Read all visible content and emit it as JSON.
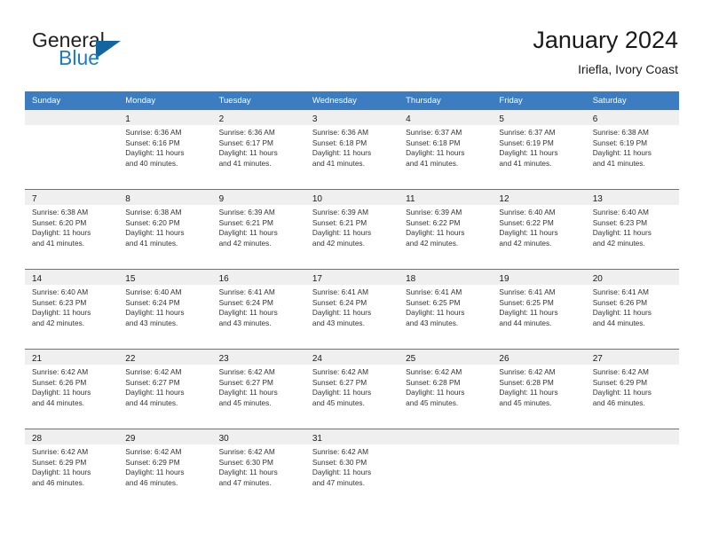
{
  "brand": {
    "word1": "General",
    "word2": "Blue",
    "flag_icon": "triangle-flag-icon",
    "accent_color": "#1e7bc4"
  },
  "header": {
    "title": "January 2024",
    "subtitle": "Iriefla, Ivory Coast"
  },
  "theme": {
    "header_blue": "#3b7dc0",
    "day_band_gray": "#efefef",
    "text_color": "#333333"
  },
  "calendar": {
    "weekday_headers": [
      "Sunday",
      "Monday",
      "Tuesday",
      "Wednesday",
      "Thursday",
      "Friday",
      "Saturday"
    ],
    "weeks": [
      [
        {
          "day": "",
          "sunrise": "",
          "sunset": "",
          "daylight_line1": "",
          "daylight_line2": ""
        },
        {
          "day": "1",
          "sunrise": "Sunrise: 6:36 AM",
          "sunset": "Sunset: 6:16 PM",
          "daylight_line1": "Daylight: 11 hours",
          "daylight_line2": "and 40 minutes."
        },
        {
          "day": "2",
          "sunrise": "Sunrise: 6:36 AM",
          "sunset": "Sunset: 6:17 PM",
          "daylight_line1": "Daylight: 11 hours",
          "daylight_line2": "and 41 minutes."
        },
        {
          "day": "3",
          "sunrise": "Sunrise: 6:36 AM",
          "sunset": "Sunset: 6:18 PM",
          "daylight_line1": "Daylight: 11 hours",
          "daylight_line2": "and 41 minutes."
        },
        {
          "day": "4",
          "sunrise": "Sunrise: 6:37 AM",
          "sunset": "Sunset: 6:18 PM",
          "daylight_line1": "Daylight: 11 hours",
          "daylight_line2": "and 41 minutes."
        },
        {
          "day": "5",
          "sunrise": "Sunrise: 6:37 AM",
          "sunset": "Sunset: 6:19 PM",
          "daylight_line1": "Daylight: 11 hours",
          "daylight_line2": "and 41 minutes."
        },
        {
          "day": "6",
          "sunrise": "Sunrise: 6:38 AM",
          "sunset": "Sunset: 6:19 PM",
          "daylight_line1": "Daylight: 11 hours",
          "daylight_line2": "and 41 minutes."
        }
      ],
      [
        {
          "day": "7",
          "sunrise": "Sunrise: 6:38 AM",
          "sunset": "Sunset: 6:20 PM",
          "daylight_line1": "Daylight: 11 hours",
          "daylight_line2": "and 41 minutes."
        },
        {
          "day": "8",
          "sunrise": "Sunrise: 6:38 AM",
          "sunset": "Sunset: 6:20 PM",
          "daylight_line1": "Daylight: 11 hours",
          "daylight_line2": "and 41 minutes."
        },
        {
          "day": "9",
          "sunrise": "Sunrise: 6:39 AM",
          "sunset": "Sunset: 6:21 PM",
          "daylight_line1": "Daylight: 11 hours",
          "daylight_line2": "and 42 minutes."
        },
        {
          "day": "10",
          "sunrise": "Sunrise: 6:39 AM",
          "sunset": "Sunset: 6:21 PM",
          "daylight_line1": "Daylight: 11 hours",
          "daylight_line2": "and 42 minutes."
        },
        {
          "day": "11",
          "sunrise": "Sunrise: 6:39 AM",
          "sunset": "Sunset: 6:22 PM",
          "daylight_line1": "Daylight: 11 hours",
          "daylight_line2": "and 42 minutes."
        },
        {
          "day": "12",
          "sunrise": "Sunrise: 6:40 AM",
          "sunset": "Sunset: 6:22 PM",
          "daylight_line1": "Daylight: 11 hours",
          "daylight_line2": "and 42 minutes."
        },
        {
          "day": "13",
          "sunrise": "Sunrise: 6:40 AM",
          "sunset": "Sunset: 6:23 PM",
          "daylight_line1": "Daylight: 11 hours",
          "daylight_line2": "and 42 minutes."
        }
      ],
      [
        {
          "day": "14",
          "sunrise": "Sunrise: 6:40 AM",
          "sunset": "Sunset: 6:23 PM",
          "daylight_line1": "Daylight: 11 hours",
          "daylight_line2": "and 42 minutes."
        },
        {
          "day": "15",
          "sunrise": "Sunrise: 6:40 AM",
          "sunset": "Sunset: 6:24 PM",
          "daylight_line1": "Daylight: 11 hours",
          "daylight_line2": "and 43 minutes."
        },
        {
          "day": "16",
          "sunrise": "Sunrise: 6:41 AM",
          "sunset": "Sunset: 6:24 PM",
          "daylight_line1": "Daylight: 11 hours",
          "daylight_line2": "and 43 minutes."
        },
        {
          "day": "17",
          "sunrise": "Sunrise: 6:41 AM",
          "sunset": "Sunset: 6:24 PM",
          "daylight_line1": "Daylight: 11 hours",
          "daylight_line2": "and 43 minutes."
        },
        {
          "day": "18",
          "sunrise": "Sunrise: 6:41 AM",
          "sunset": "Sunset: 6:25 PM",
          "daylight_line1": "Daylight: 11 hours",
          "daylight_line2": "and 43 minutes."
        },
        {
          "day": "19",
          "sunrise": "Sunrise: 6:41 AM",
          "sunset": "Sunset: 6:25 PM",
          "daylight_line1": "Daylight: 11 hours",
          "daylight_line2": "and 44 minutes."
        },
        {
          "day": "20",
          "sunrise": "Sunrise: 6:41 AM",
          "sunset": "Sunset: 6:26 PM",
          "daylight_line1": "Daylight: 11 hours",
          "daylight_line2": "and 44 minutes."
        }
      ],
      [
        {
          "day": "21",
          "sunrise": "Sunrise: 6:42 AM",
          "sunset": "Sunset: 6:26 PM",
          "daylight_line1": "Daylight: 11 hours",
          "daylight_line2": "and 44 minutes."
        },
        {
          "day": "22",
          "sunrise": "Sunrise: 6:42 AM",
          "sunset": "Sunset: 6:27 PM",
          "daylight_line1": "Daylight: 11 hours",
          "daylight_line2": "and 44 minutes."
        },
        {
          "day": "23",
          "sunrise": "Sunrise: 6:42 AM",
          "sunset": "Sunset: 6:27 PM",
          "daylight_line1": "Daylight: 11 hours",
          "daylight_line2": "and 45 minutes."
        },
        {
          "day": "24",
          "sunrise": "Sunrise: 6:42 AM",
          "sunset": "Sunset: 6:27 PM",
          "daylight_line1": "Daylight: 11 hours",
          "daylight_line2": "and 45 minutes."
        },
        {
          "day": "25",
          "sunrise": "Sunrise: 6:42 AM",
          "sunset": "Sunset: 6:28 PM",
          "daylight_line1": "Daylight: 11 hours",
          "daylight_line2": "and 45 minutes."
        },
        {
          "day": "26",
          "sunrise": "Sunrise: 6:42 AM",
          "sunset": "Sunset: 6:28 PM",
          "daylight_line1": "Daylight: 11 hours",
          "daylight_line2": "and 45 minutes."
        },
        {
          "day": "27",
          "sunrise": "Sunrise: 6:42 AM",
          "sunset": "Sunset: 6:29 PM",
          "daylight_line1": "Daylight: 11 hours",
          "daylight_line2": "and 46 minutes."
        }
      ],
      [
        {
          "day": "28",
          "sunrise": "Sunrise: 6:42 AM",
          "sunset": "Sunset: 6:29 PM",
          "daylight_line1": "Daylight: 11 hours",
          "daylight_line2": "and 46 minutes."
        },
        {
          "day": "29",
          "sunrise": "Sunrise: 6:42 AM",
          "sunset": "Sunset: 6:29 PM",
          "daylight_line1": "Daylight: 11 hours",
          "daylight_line2": "and 46 minutes."
        },
        {
          "day": "30",
          "sunrise": "Sunrise: 6:42 AM",
          "sunset": "Sunset: 6:30 PM",
          "daylight_line1": "Daylight: 11 hours",
          "daylight_line2": "and 47 minutes."
        },
        {
          "day": "31",
          "sunrise": "Sunrise: 6:42 AM",
          "sunset": "Sunset: 6:30 PM",
          "daylight_line1": "Daylight: 11 hours",
          "daylight_line2": "and 47 minutes."
        },
        {
          "day": "",
          "sunrise": "",
          "sunset": "",
          "daylight_line1": "",
          "daylight_line2": ""
        },
        {
          "day": "",
          "sunrise": "",
          "sunset": "",
          "daylight_line1": "",
          "daylight_line2": ""
        },
        {
          "day": "",
          "sunrise": "",
          "sunset": "",
          "daylight_line1": "",
          "daylight_line2": ""
        }
      ]
    ]
  }
}
